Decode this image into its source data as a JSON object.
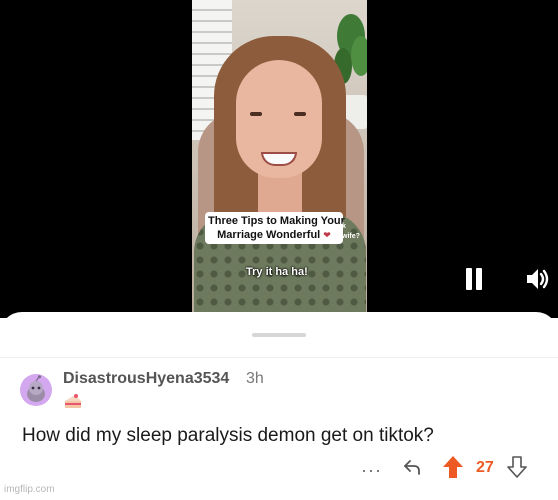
{
  "video": {
    "caption_line1": "Three Tips to Making Your",
    "caption_line2": "Marriage Wonderful",
    "side_text_line1": "k",
    "side_text_line2": "wife?",
    "subtitle": "Try it ha ha!"
  },
  "controls": {
    "pause_icon": "pause-icon",
    "sound_icon": "speaker-icon"
  },
  "comment": {
    "username": "DisastrousHyena3534",
    "time": "3h",
    "flair_icon": "cake-icon",
    "body": "How did my sleep paralysis demon get on tiktok?",
    "more": "···",
    "votes": "27"
  },
  "colors": {
    "upvote": "#ee5a24",
    "avatar_bg": "#d3a8ee"
  },
  "watermark": "imgflip.com"
}
